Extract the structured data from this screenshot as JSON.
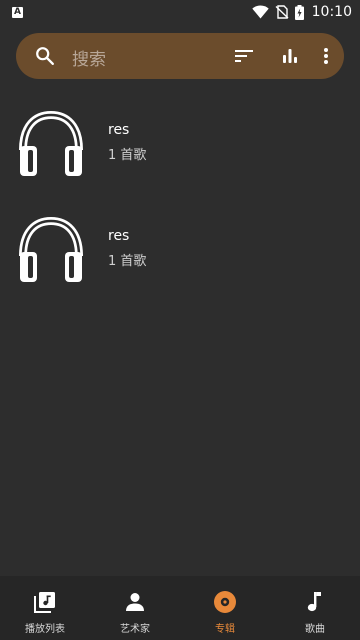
{
  "status_bar": {
    "notification_icon": "A",
    "time": "10:10",
    "icons": [
      "wifi-icon",
      "no-sim-icon",
      "battery-charging-icon"
    ]
  },
  "search": {
    "placeholder": "搜索",
    "icons": [
      "search-icon",
      "sort-icon",
      "equalizer-icon",
      "more-vert-icon"
    ],
    "background_color": "#6b4c2c"
  },
  "albums": [
    {
      "title": "res",
      "count": "1 首歌",
      "icon": "headphones-icon"
    },
    {
      "title": "res",
      "count": "1 首歌",
      "icon": "headphones-icon"
    }
  ],
  "bottom_nav": {
    "active_color": "#e8893a",
    "items": [
      {
        "label": "播放列表",
        "icon": "playlist-icon",
        "active": false
      },
      {
        "label": "艺术家",
        "icon": "artist-icon",
        "active": false
      },
      {
        "label": "专辑",
        "icon": "album-icon",
        "active": true
      },
      {
        "label": "歌曲",
        "icon": "music-note-icon",
        "active": false
      }
    ]
  }
}
